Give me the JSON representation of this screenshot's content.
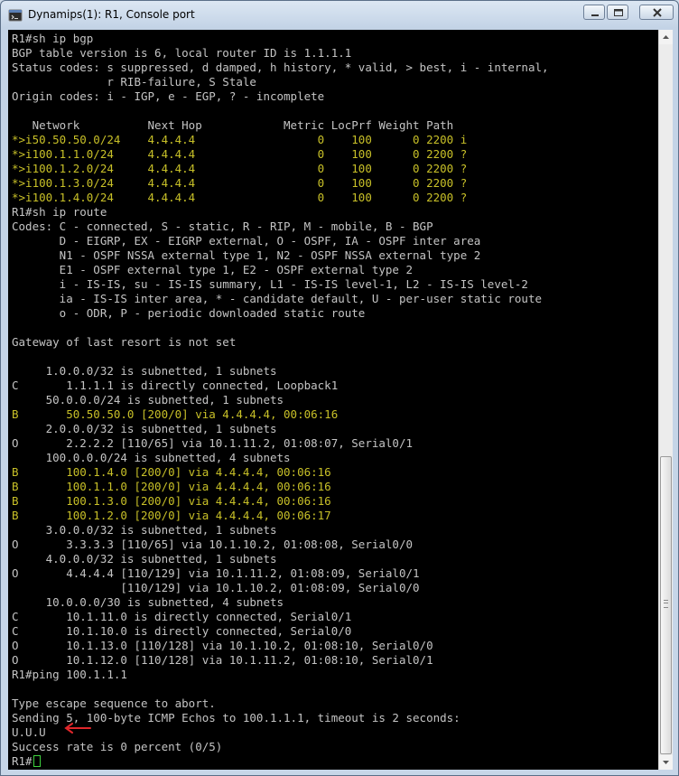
{
  "window": {
    "title": "Dynamips(1): R1, Console port",
    "buttons": {
      "minimize": "minimize",
      "maximize": "maximize",
      "close": "close"
    }
  },
  "console": {
    "lines": [
      "R1#sh ip bgp",
      "BGP table version is 6, local router ID is 1.1.1.1",
      "Status codes: s suppressed, d damped, h history, * valid, > best, i - internal,",
      "              r RIB-failure, S Stale",
      "Origin codes: i - IGP, e - EGP, ? - incomplete",
      "",
      "   Network          Next Hop            Metric LocPrf Weight Path",
      "*>i50.50.50.0/24    4.4.4.4                  0    100      0 2200 i",
      "*>i100.1.1.0/24     4.4.4.4                  0    100      0 2200 ?",
      "*>i100.1.2.0/24     4.4.4.4                  0    100      0 2200 ?",
      "*>i100.1.3.0/24     4.4.4.4                  0    100      0 2200 ?",
      "*>i100.1.4.0/24     4.4.4.4                  0    100      0 2200 ?",
      "R1#sh ip route",
      "Codes: C - connected, S - static, R - RIP, M - mobile, B - BGP",
      "       D - EIGRP, EX - EIGRP external, O - OSPF, IA - OSPF inter area",
      "       N1 - OSPF NSSA external type 1, N2 - OSPF NSSA external type 2",
      "       E1 - OSPF external type 1, E2 - OSPF external type 2",
      "       i - IS-IS, su - IS-IS summary, L1 - IS-IS level-1, L2 - IS-IS level-2",
      "       ia - IS-IS inter area, * - candidate default, U - per-user static route",
      "       o - ODR, P - periodic downloaded static route",
      "",
      "Gateway of last resort is not set",
      "",
      "     1.0.0.0/32 is subnetted, 1 subnets",
      "C       1.1.1.1 is directly connected, Loopback1",
      "     50.0.0.0/24 is subnetted, 1 subnets",
      "B       50.50.50.0 [200/0] via 4.4.4.4, 00:06:16",
      "     2.0.0.0/32 is subnetted, 1 subnets",
      "O       2.2.2.2 [110/65] via 10.1.11.2, 01:08:07, Serial0/1",
      "     100.0.0.0/24 is subnetted, 4 subnets",
      "B       100.1.4.0 [200/0] via 4.4.4.4, 00:06:16",
      "B       100.1.1.0 [200/0] via 4.4.4.4, 00:06:16",
      "B       100.1.3.0 [200/0] via 4.4.4.4, 00:06:16",
      "B       100.1.2.0 [200/0] via 4.4.4.4, 00:06:17",
      "     3.0.0.0/32 is subnetted, 1 subnets",
      "O       3.3.3.3 [110/65] via 10.1.10.2, 01:08:08, Serial0/0",
      "     4.0.0.0/32 is subnetted, 1 subnets",
      "O       4.4.4.4 [110/129] via 10.1.11.2, 01:08:09, Serial0/1",
      "                [110/129] via 10.1.10.2, 01:08:09, Serial0/0",
      "     10.0.0.0/30 is subnetted, 4 subnets",
      "C       10.1.11.0 is directly connected, Serial0/1",
      "C       10.1.10.0 is directly connected, Serial0/0",
      "O       10.1.13.0 [110/128] via 10.1.10.2, 01:08:10, Serial0/0",
      "O       10.1.12.0 [110/128] via 10.1.11.2, 01:08:10, Serial0/1",
      "R1#ping 100.1.1.1",
      "",
      "Type escape sequence to abort.",
      "Sending 5, 100-byte ICMP Echos to 100.1.1.1, timeout is 2 seconds:",
      "U.U.U",
      "Success rate is 0 percent (0/5)",
      "R1#"
    ],
    "highlighted_lines": [
      7,
      8,
      9,
      10,
      11,
      26,
      30,
      31,
      32,
      33
    ],
    "colors": {
      "background": "#000000",
      "text": "#c4c4c4",
      "highlight": "#c8c028",
      "cursor": "#3fd23f",
      "annotation_arrow": "#e0262a"
    }
  },
  "annotation": {
    "icon": "red-arrow-icon"
  }
}
